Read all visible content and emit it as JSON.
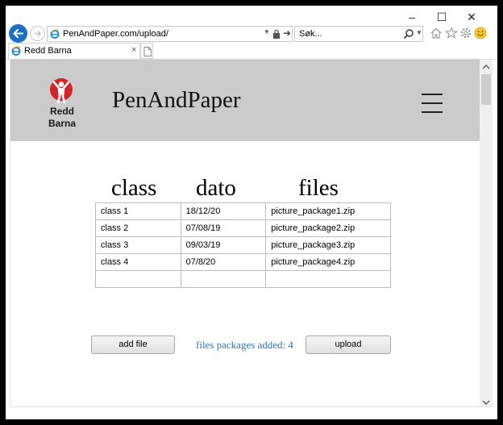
{
  "browser": {
    "address": "PenAndPaper.com/upload/",
    "search_placeholder": "Søk...",
    "tab_title": "Redd Barna",
    "tab_close": "×",
    "window_buttons": {
      "minimize": "–",
      "maximize": "☐",
      "close": "✕"
    }
  },
  "site": {
    "logo_line1": "Redd",
    "logo_line2": "Barna",
    "name": "PenAndPaper",
    "accent_color": "#d62328",
    "header_color": "#cbcbcb"
  },
  "table": {
    "headers": [
      "class",
      "dato",
      "files"
    ],
    "rows": [
      [
        "class 1",
        "18/12/20",
        "picture_package1.zip"
      ],
      [
        "class 2",
        "07/08/19",
        "picture_package2.zip"
      ],
      [
        "class 3",
        "09/03/19",
        "picture_package3.zip"
      ],
      [
        "class 4",
        "07/8/20",
        "picture_package4.zip"
      ],
      [
        "",
        "",
        ""
      ]
    ]
  },
  "actions": {
    "add_file": "add file",
    "status": "files packages added: 4",
    "upload": "upload",
    "status_color": "#2e74b5"
  }
}
